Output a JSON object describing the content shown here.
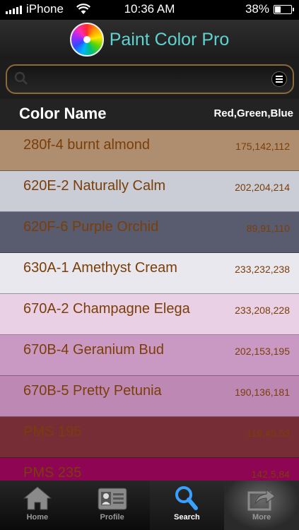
{
  "status_bar": {
    "carrier": "iPhone",
    "time": "10:36 AM",
    "battery": "38%",
    "battery_level": 0.38
  },
  "app": {
    "title": "Paint Color Pro",
    "logo_icon": "color-wheel-icon"
  },
  "search": {
    "placeholder": "",
    "value": "",
    "icon": "search-icon",
    "menu_icon": "menu-icon"
  },
  "columns": {
    "name": "Color Name",
    "rgb": "Red,Green,Blue"
  },
  "colors": [
    {
      "name": "280f-4 burnt almond",
      "rgb": "175,142,112",
      "swatch": "#af8e70"
    },
    {
      "name": "620E-2 Naturally Calm",
      "rgb": "202,204,214",
      "swatch": "#caccd6"
    },
    {
      "name": "620F-6 Purple Orchid",
      "rgb": "89,91,110",
      "swatch": "#595b6e"
    },
    {
      "name": "630A-1 Amethyst Cream",
      "rgb": "233,232,238",
      "swatch": "#e9e8ee"
    },
    {
      "name": "670A-2 Champagne Elega",
      "rgb": "233,208,228",
      "swatch": "#e9d0e4"
    },
    {
      "name": "670B-4 Geranium Bud",
      "rgb": "202,153,195",
      "swatch": "#ca99c3"
    },
    {
      "name": "670B-5 Pretty Petunia",
      "rgb": "190,136,181",
      "swatch": "#be88b5"
    },
    {
      "name": "PMS 195",
      "rgb": "119,45,53",
      "swatch": "#772d35"
    },
    {
      "name": "PMS 235",
      "rgb": "142,5,84",
      "swatch": "#8e0554"
    }
  ],
  "tabs": [
    {
      "label": "Home",
      "icon": "home-icon",
      "active": false
    },
    {
      "label": "Profile",
      "icon": "profile-card-icon",
      "active": false
    },
    {
      "label": "Search",
      "icon": "magnifier-icon",
      "active": true
    },
    {
      "label": "More",
      "icon": "share-arrow-icon",
      "active": false
    }
  ],
  "text_color": "#7a3e08",
  "accent_color": "#5fd3d0"
}
